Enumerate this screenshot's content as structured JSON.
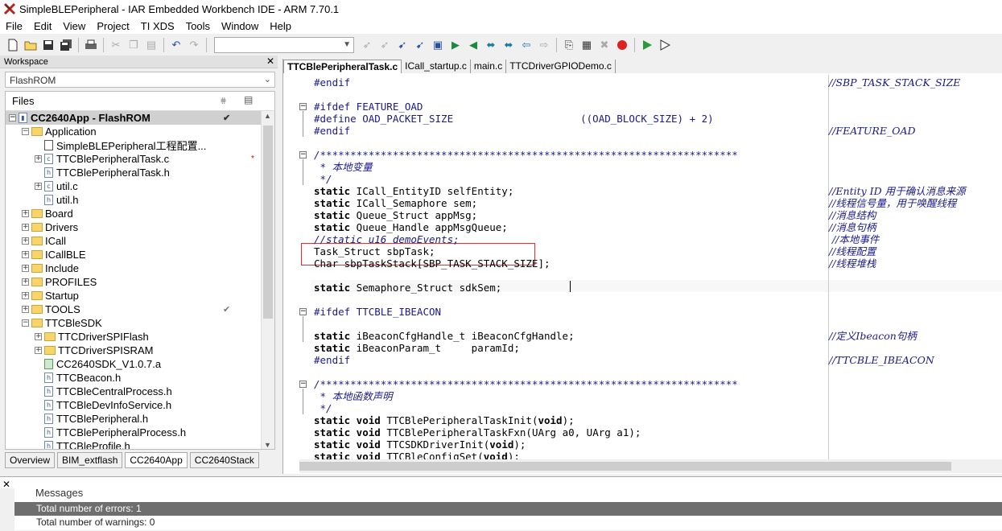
{
  "window": {
    "title": "SimpleBLEPeripheral - IAR Embedded Workbench IDE - ARM 7.70.1"
  },
  "menu": [
    "File",
    "Edit",
    "View",
    "Project",
    "TI XDS",
    "Tools",
    "Window",
    "Help"
  ],
  "workspace": {
    "header": "Workspace",
    "config": "FlashROM",
    "files_label": "Files",
    "tree": [
      {
        "label": "CC2640App - FlashROM",
        "level": 0,
        "type": "project",
        "expander": "-",
        "check": "dark",
        "selected": true
      },
      {
        "label": "Application",
        "level": 1,
        "type": "folder",
        "expander": "-"
      },
      {
        "label": "SimpleBLEPeripheral工程配置...",
        "level": 2,
        "type": "doc",
        "expander": ""
      },
      {
        "label": "TTCBlePeripheralTask.c",
        "level": 2,
        "type": "c",
        "expander": "+",
        "mark": "*"
      },
      {
        "label": "TTCBlePeripheralTask.h",
        "level": 2,
        "type": "h",
        "expander": ""
      },
      {
        "label": "util.c",
        "level": 2,
        "type": "c",
        "expander": "+"
      },
      {
        "label": "util.h",
        "level": 2,
        "type": "h",
        "expander": ""
      },
      {
        "label": "Board",
        "level": 1,
        "type": "folder",
        "expander": "+"
      },
      {
        "label": "Drivers",
        "level": 1,
        "type": "folder",
        "expander": "+"
      },
      {
        "label": "ICall",
        "level": 1,
        "type": "folder",
        "expander": "+"
      },
      {
        "label": "ICallBLE",
        "level": 1,
        "type": "folder",
        "expander": "+"
      },
      {
        "label": "Include",
        "level": 1,
        "type": "folder",
        "expander": "+"
      },
      {
        "label": "PROFILES",
        "level": 1,
        "type": "folder",
        "expander": "+"
      },
      {
        "label": "Startup",
        "level": 1,
        "type": "folder",
        "expander": "+"
      },
      {
        "label": "TOOLS",
        "level": 1,
        "type": "folder",
        "expander": "+",
        "check": "light"
      },
      {
        "label": "TTCBleSDK",
        "level": 1,
        "type": "folder",
        "expander": "-"
      },
      {
        "label": "TTCDriverSPIFlash",
        "level": 2,
        "type": "folder",
        "expander": "+"
      },
      {
        "label": "TTCDriverSPISRAM",
        "level": 2,
        "type": "folder",
        "expander": "+"
      },
      {
        "label": "CC2640SDK_V1.0.7.a",
        "level": 2,
        "type": "lib",
        "expander": ""
      },
      {
        "label": "TTCBeacon.h",
        "level": 2,
        "type": "h",
        "expander": ""
      },
      {
        "label": "TTCBleCentralProcess.h",
        "level": 2,
        "type": "h",
        "expander": ""
      },
      {
        "label": "TTCBleDevInfoService.h",
        "level": 2,
        "type": "h",
        "expander": ""
      },
      {
        "label": "TTCBlePeripheral.h",
        "level": 2,
        "type": "h",
        "expander": ""
      },
      {
        "label": "TTCBlePeripheralProcess.h",
        "level": 2,
        "type": "h",
        "expander": ""
      },
      {
        "label": "TTCBleProfile.h",
        "level": 2,
        "type": "h",
        "expander": ""
      }
    ],
    "tabs": [
      "Overview",
      "BIM_extflash",
      "CC2640App",
      "CC2640Stack"
    ],
    "active_tab": "CC2640App"
  },
  "editor": {
    "tabs": [
      "TTCBlePeripheralTask.c",
      "ICall_startup.c",
      "main.c",
      "TTCDriverGPIODemo.c"
    ],
    "lines": [
      {
        "row": 0,
        "code": "#endif",
        "cls": "pp",
        "comment": "//SBP_TASK_STACK_SIZE"
      },
      {
        "row": 2,
        "code": "#ifdef FEATURE_OAD",
        "cls": "pp",
        "fold": "-"
      },
      {
        "row": 3,
        "code": "#define OAD_PACKET_SIZE                     ((OAD_BLOCK_SIZE) + 2)",
        "cls": "pp"
      },
      {
        "row": 4,
        "code": "#endif",
        "cls": "pp",
        "comment": "//FEATURE_OAD"
      },
      {
        "row": 6,
        "code": "/*********************************************************************",
        "cls": "cm",
        "fold": "-"
      },
      {
        "row": 7,
        "code": " * 本地变量",
        "cls": "cm"
      },
      {
        "row": 8,
        "code": " */",
        "cls": "cm"
      },
      {
        "row": 9,
        "kw": "static",
        "code": " ICall_EntityID selfEntity;",
        "comment": "//Entity ID 用于确认消息来源"
      },
      {
        "row": 10,
        "kw": "static",
        "code": " ICall_Semaphore sem;",
        "comment": "//线程信号量，用于唤醒线程"
      },
      {
        "row": 11,
        "kw": "static",
        "code": " Queue_Struct appMsg;",
        "comment": "//消息结构"
      },
      {
        "row": 12,
        "kw": "static",
        "code": " Queue_Handle appMsgQueue;",
        "comment": "//消息句柄"
      },
      {
        "row": 13,
        "code": "//static u16 demoEvents;",
        "cls": "cm",
        "comment": " //本地事件"
      },
      {
        "row": 14,
        "code": "Task_Struct sbpTask;",
        "comment": "//线程配置"
      },
      {
        "row": 15,
        "code": "Char sbpTaskStack[SBP_TASK_STACK_SIZE];",
        "comment": "//线程堆栈"
      },
      {
        "row": 17,
        "kw": "static",
        "code": " Semaphore_Struct sdkSem;"
      },
      {
        "row": 19,
        "code": "#ifdef TTCBLE_IBEACON",
        "cls": "pp",
        "fold": "-"
      },
      {
        "row": 21,
        "kw": "static",
        "code": " iBeaconCfgHandle_t iBeaconCfgHandle;",
        "comment": "//定义Ibeacon句柄"
      },
      {
        "row": 22,
        "kw": "static",
        "code": " iBeaconParam_t     paramId;"
      },
      {
        "row": 23,
        "code": "#endif",
        "cls": "pp",
        "comment": "//TTCBLE_IBEACON"
      },
      {
        "row": 25,
        "code": "/*********************************************************************",
        "cls": "cm",
        "fold": "-"
      },
      {
        "row": 26,
        "code": " * 本地函数声明",
        "cls": "cm"
      },
      {
        "row": 27,
        "code": " */",
        "cls": "cm"
      },
      {
        "row": 28,
        "kw": "static void",
        "code": " TTCBlePeripheralTaskInit(",
        "kw2": "void",
        "tail": ");"
      },
      {
        "row": 29,
        "kw": "static void",
        "code": " TTCBlePeripheralTaskFxn(UArg a0, UArg a1);"
      },
      {
        "row": 30,
        "kw": "static void",
        "code": " TTCSDKDriverInit(",
        "kw2": "void",
        "tail": ");"
      },
      {
        "row": 31,
        "kw": "static void",
        "code": " TTCBleConfigSet(",
        "kw2": "void",
        "tail": ");"
      }
    ]
  },
  "messages": {
    "header": "Messages",
    "rows": [
      "Total number of errors: 1",
      "Total number of warnings: 0"
    ]
  },
  "colors": {
    "selection_row": "#6e6e6e",
    "comment": "#1a1a8a",
    "highlight_box": "#e03030",
    "folder": "#f7d56a"
  },
  "toolbar_icons": [
    "new-file-icon",
    "open-icon",
    "save-icon",
    "save-all-icon",
    "print-icon",
    "cut-icon",
    "copy-icon",
    "paste-icon",
    "undo-icon",
    "redo-icon",
    "toggle-bookmark-icon",
    "next-bookmark-icon",
    "find-icon",
    "replace-icon",
    "navigate-back-icon",
    "navigate-forward-icon",
    "compile-icon",
    "make-icon",
    "stop-build-icon",
    "toggle-breakpoint-icon",
    "download-debug-icon",
    "debug-without-download-icon"
  ]
}
